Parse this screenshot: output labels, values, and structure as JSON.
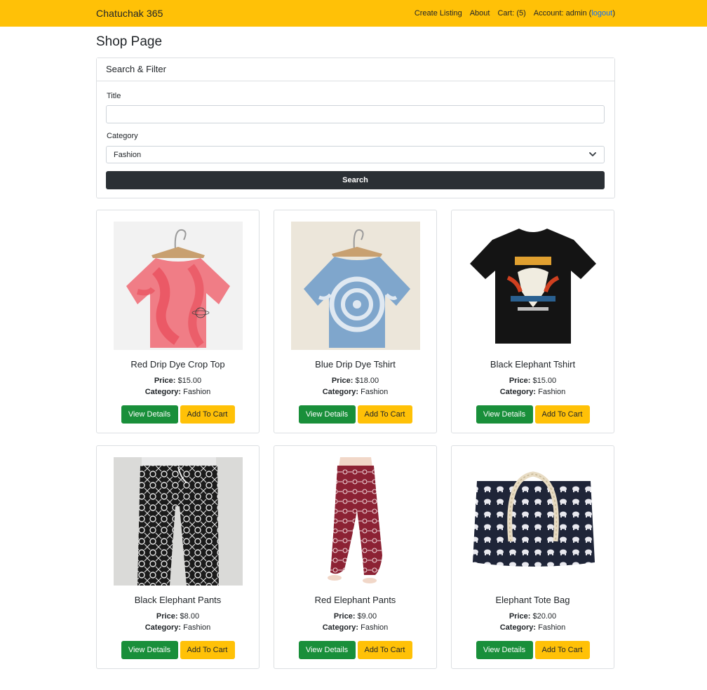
{
  "nav": {
    "brand": "Chatuchak 365",
    "create_listing": "Create Listing",
    "about": "About",
    "cart": "Cart: (5)",
    "account_prefix": "Account: admin (",
    "logout": "logout",
    "account_suffix": ")"
  },
  "page_title": "Shop Page",
  "filter": {
    "header": "Search & Filter",
    "title_label": "Title",
    "title_value": "",
    "category_label": "Category",
    "category_selected": "Fashion",
    "search_button": "Search"
  },
  "labels": {
    "price": "Price:",
    "category": "Category:",
    "view_details": "View Details",
    "add_to_cart": "Add To Cart"
  },
  "products": [
    {
      "title": "Red Drip Dye Crop Top",
      "price": "$15.00",
      "category": "Fashion"
    },
    {
      "title": "Blue Drip Dye Tshirt",
      "price": "$18.00",
      "category": "Fashion"
    },
    {
      "title": "Black Elephant Tshirt",
      "price": "$15.00",
      "category": "Fashion"
    },
    {
      "title": "Black Elephant Pants",
      "price": "$8.00",
      "category": "Fashion"
    },
    {
      "title": "Red Elephant Pants",
      "price": "$9.00",
      "category": "Fashion"
    },
    {
      "title": "Elephant Tote Bag",
      "price": "$20.00",
      "category": "Fashion"
    }
  ],
  "colors": {
    "navbar": "#ffc107",
    "search_button": "#2b3035",
    "view_button": "#198f3a",
    "cart_button": "#ffc107",
    "link": "#0d6efd"
  }
}
